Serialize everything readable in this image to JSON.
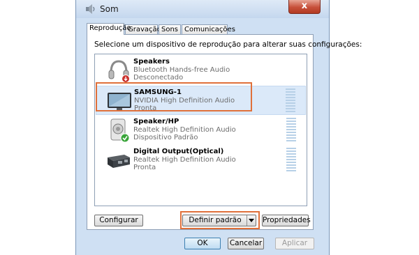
{
  "window": {
    "title": "Som",
    "close_label": "x"
  },
  "tabs": [
    {
      "label": "Reprodução",
      "active": true
    },
    {
      "label": "Gravação",
      "active": false
    },
    {
      "label": "Sons",
      "active": false
    },
    {
      "label": "Comunicações",
      "active": false
    }
  ],
  "instruction": "Selecione um dispositivo de reprodução para alterar suas configurações:",
  "devices": [
    {
      "name": "Speakers",
      "driver": "Bluetooth Hands-free Audio",
      "status": "Desconectado",
      "icon": "headset-icon",
      "badge": "disconnected"
    },
    {
      "name": "SAMSUNG-1",
      "driver": "NVIDIA High Definition Audio",
      "status": "Pronta",
      "icon": "monitor-icon",
      "badge": "none",
      "selected": true
    },
    {
      "name": "Speaker/HP",
      "driver": "Realtek High Definition Audio",
      "status": "Dispositivo Padrão",
      "icon": "speaker-icon",
      "badge": "default-check"
    },
    {
      "name": "Digital Output(Optical)",
      "driver": "Realtek High Definition Audio",
      "status": "Pronta",
      "icon": "optical-output-icon",
      "badge": "none"
    }
  ],
  "buttons": {
    "configure": "Configurar",
    "set_default": "Definir padrão",
    "properties": "Propriedades",
    "ok": "OK",
    "cancel": "Cancelar",
    "apply": "Aplicar"
  },
  "colors": {
    "highlight": "#e0703a",
    "selection": "#dbe9f9",
    "close_button": "#c7503a",
    "level_meter": "#b7d0e7"
  }
}
